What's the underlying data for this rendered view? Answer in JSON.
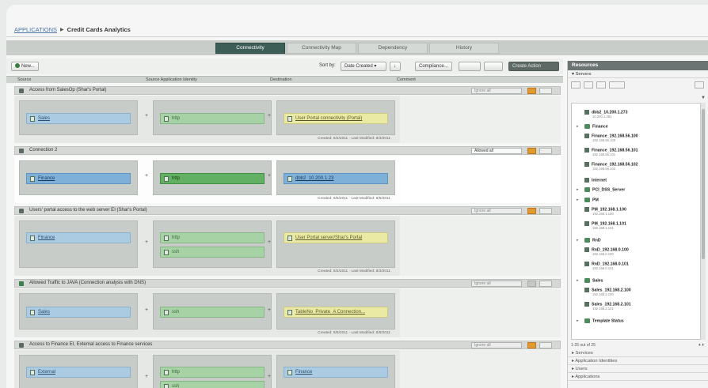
{
  "breadcrumb": {
    "parent": "APPLICATIONS",
    "current": "Credit Cards Analytics"
  },
  "tabs": [
    "Connectivity",
    "Connectivity Map",
    "Dependency",
    "History"
  ],
  "toolbar": {
    "new_label": "New...",
    "sort_label": "Sort by:",
    "sort_value": "Date Created",
    "compliance_label": "Compliance...",
    "create_action": "Create Action"
  },
  "columns": {
    "source": "Source",
    "source_app": "Source Application Identity",
    "destination": "Destination",
    "comment": "Comment"
  },
  "rules": [
    {
      "title": "Access from SalesOp (Shar's Portal)",
      "control": "Ignore all",
      "source": [
        "Sales"
      ],
      "app": [
        "http"
      ],
      "dest": "User Portal connectivity (Portal)",
      "meta": "Created: 8/2/2011 · Last Modified: 8/3/2011"
    },
    {
      "title": "Connection 2",
      "control": "Allowed all",
      "source": [
        "Finance"
      ],
      "app": [
        "http"
      ],
      "dest": "dbb2_10.200.1.23",
      "meta": "Created: 8/5/2011 · Last Modified: 8/5/2011"
    },
    {
      "title": "Users' portal access to the web server EI (Shar's Portal)",
      "control": "Ignore all",
      "source": [
        "Finance"
      ],
      "app": [
        "http",
        "ssh"
      ],
      "dest": "User Portal server/Shar's Portal",
      "meta": "Created: 8/2/2011 · Last Modified: 8/3/2011"
    },
    {
      "title": "Allowed Traffic to JAVA (Connection analysis with DNS)",
      "control": "Ignore all",
      "source": [
        "Sales"
      ],
      "app": [
        "ssh"
      ],
      "dest": "TableNo_Private_A Connection...",
      "meta": "Created: 8/8/2011 · Last Modified: 8/8/2011"
    },
    {
      "title": "Access to Finance EI, External access to Finance services",
      "control": "Ignore all",
      "source": [
        "External"
      ],
      "app": [
        "http",
        "ssh"
      ],
      "dest": "Finance",
      "meta": ""
    }
  ],
  "resources": {
    "title": "Resources",
    "section": "Servers",
    "footer": "1-25 out of 25",
    "items": [
      {
        "name": "dbb2_10.200.1.273",
        "ip": "10.200.1.281",
        "group": false
      },
      {
        "name": "Finance",
        "ip": "",
        "group": true
      },
      {
        "name": "Finance_192.168.56.100",
        "ip": "192.168.56.100",
        "group": false
      },
      {
        "name": "Finance_192.168.56.101",
        "ip": "192.168.56.101",
        "group": false
      },
      {
        "name": "Finance_192.168.56.102",
        "ip": "192.168.56.102",
        "group": false
      },
      {
        "name": "Internet",
        "ip": "",
        "group": false
      },
      {
        "name": "PCI_DSS_Server",
        "ip": "",
        "group": true
      },
      {
        "name": "PM",
        "ip": "",
        "group": true
      },
      {
        "name": "PM_192.168.1.100",
        "ip": "192.168.1.100",
        "group": false
      },
      {
        "name": "PM_192.168.1.101",
        "ip": "192.168.1.101",
        "group": false
      },
      {
        "name": "RnD",
        "ip": "",
        "group": true
      },
      {
        "name": "RnD_192.168.0.100",
        "ip": "192.168.0.100",
        "group": false
      },
      {
        "name": "RnD_192.168.0.101",
        "ip": "192.168.0.101",
        "group": false
      },
      {
        "name": "Sales",
        "ip": "",
        "group": true
      },
      {
        "name": "Sales_192.168.2.100",
        "ip": "192.168.2.100",
        "group": false
      },
      {
        "name": "Sales_192.168.2.101",
        "ip": "192.168.2.101",
        "group": false
      },
      {
        "name": "Template Status",
        "ip": "",
        "group": true
      }
    ],
    "bottom_sections": [
      "Services",
      "Application Identities",
      "Users",
      "Applications"
    ]
  }
}
